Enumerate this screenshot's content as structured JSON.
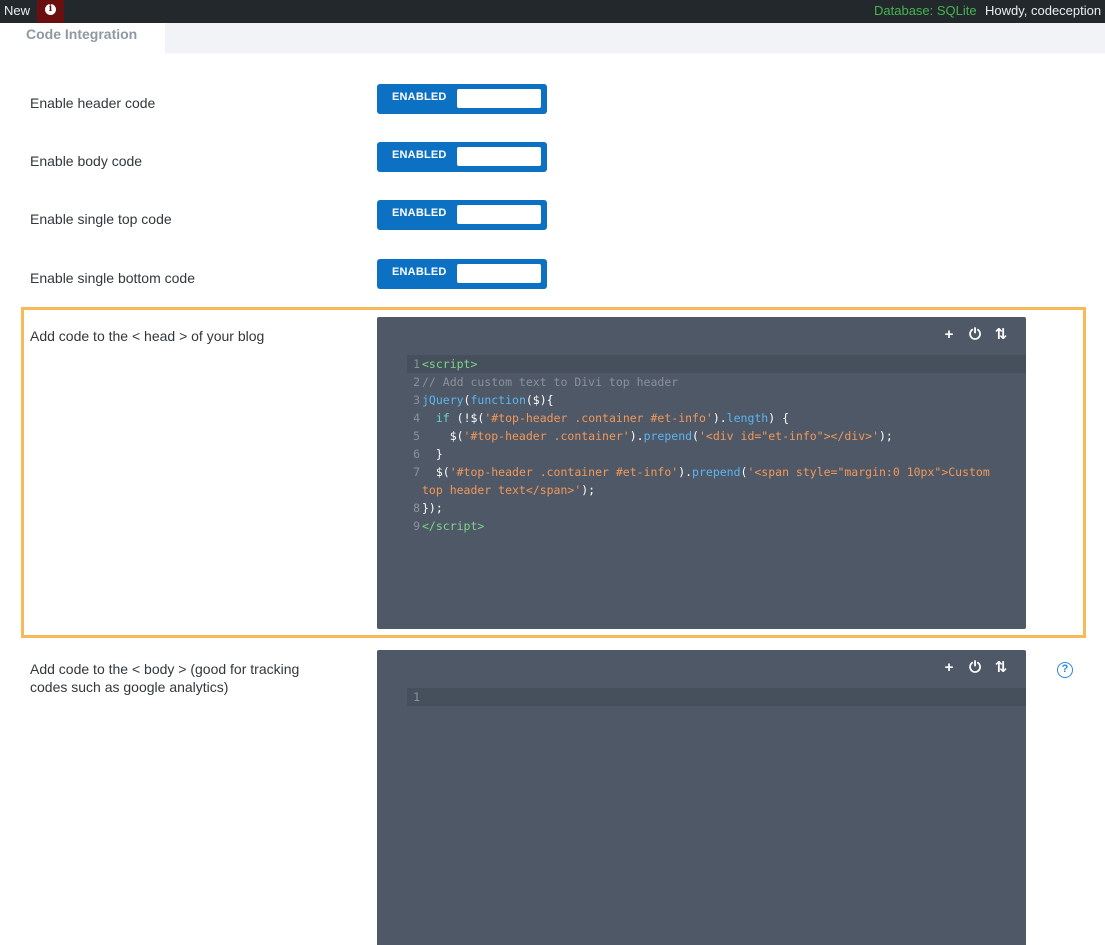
{
  "adminbar": {
    "new_label": "New",
    "info_icon": "i",
    "database_label": "Database: SQLite",
    "howdy_label": "Howdy, codeception"
  },
  "tabs": {
    "active": "Code Integration"
  },
  "settings": {
    "header_code": {
      "label": "Enable header code",
      "state": "ENABLED"
    },
    "body_code": {
      "label": "Enable body code",
      "state": "ENABLED"
    },
    "single_top_code": {
      "label": "Enable single top code",
      "state": "ENABLED"
    },
    "single_bottom_code": {
      "label": "Enable single bottom code",
      "state": "ENABLED"
    }
  },
  "head_editor": {
    "label": "Add code to the < head > of your blog",
    "tools": {
      "add": "+",
      "power": "⏻",
      "sort": "⇅"
    },
    "line_numbers": [
      "1",
      "2",
      "3",
      "4",
      "5",
      "6",
      "7",
      "8",
      "9"
    ]
  },
  "body_editor": {
    "label_line1": "Add code to the < body > (good for tracking",
    "label_line2": "codes such as google analytics)",
    "tools": {
      "add": "+",
      "power": "⏻",
      "sort": "⇅"
    },
    "line_numbers": [
      "1"
    ],
    "help_icon": "?"
  },
  "colors": {
    "admin_bar": "#23282d",
    "toggle_blue": "#0c71c3",
    "highlight_orange": "#f9b959",
    "editor_bg": "#4f5866",
    "db_green": "#46b450"
  }
}
